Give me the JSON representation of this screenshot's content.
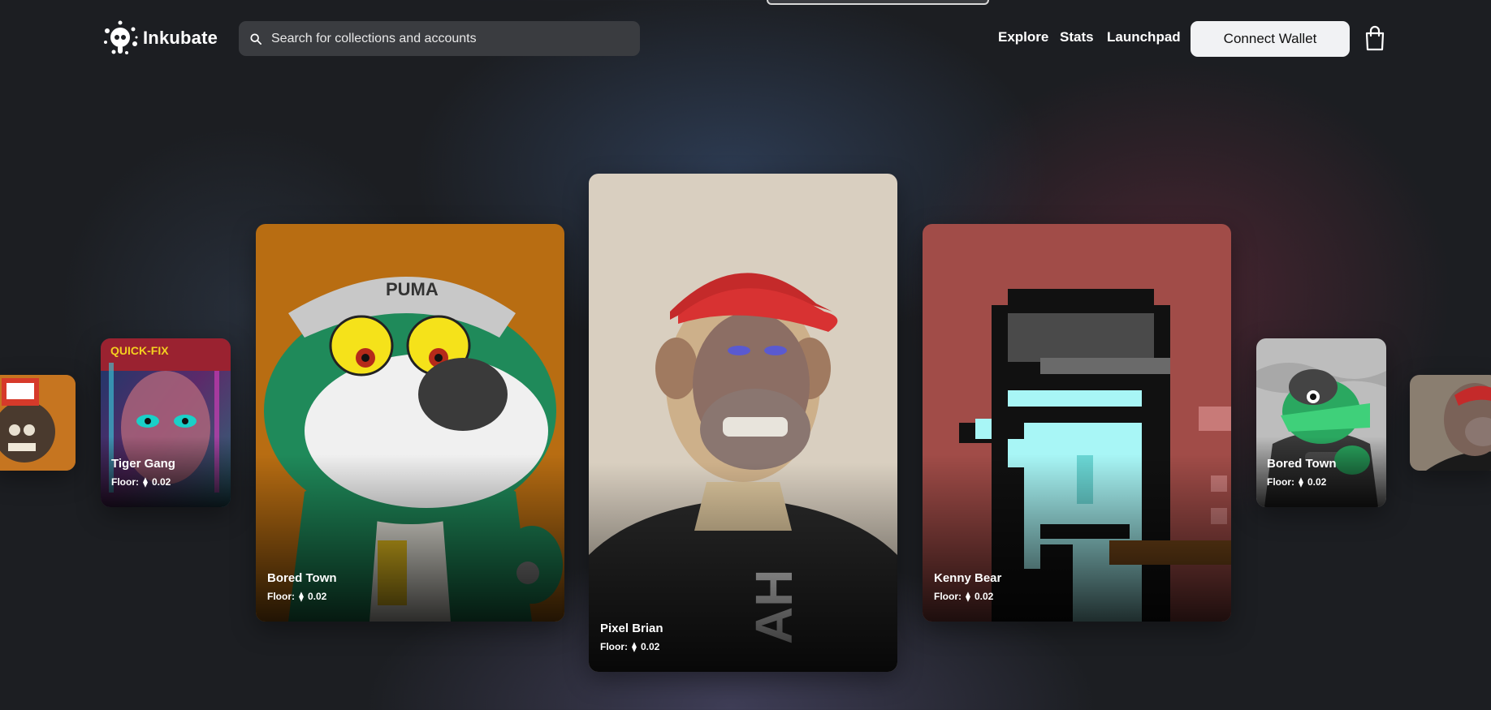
{
  "header": {
    "brand": "Inkubate",
    "search_placeholder": "Search for collections and accounts",
    "nav": {
      "explore": "Explore",
      "stats": "Stats",
      "launchpad": "Launchpad"
    },
    "connect_wallet": "Connect Wallet"
  },
  "floor_label": "Floor:",
  "cards": [
    {
      "name": "Tiger Gang",
      "floor": "0.02",
      "art_text": "QUICK-FIX"
    },
    {
      "name": "Bored Town",
      "floor": "0.02",
      "art_text": "PUMA"
    },
    {
      "name": "Pixel Brian",
      "floor": "0.02",
      "art_text": "AH"
    },
    {
      "name": "Kenny Bear",
      "floor": "0.02"
    },
    {
      "name": "Bored Town",
      "floor": "0.02"
    }
  ],
  "colors": {
    "background": "#1c1e22",
    "connect_button": "#f1f2f4",
    "search_bg": "#3a3c40",
    "card_orange": "#b86d12",
    "card_beige": "#d9cfc0",
    "card_red": "#a14c48",
    "card_gray": "#bdbdbd"
  }
}
